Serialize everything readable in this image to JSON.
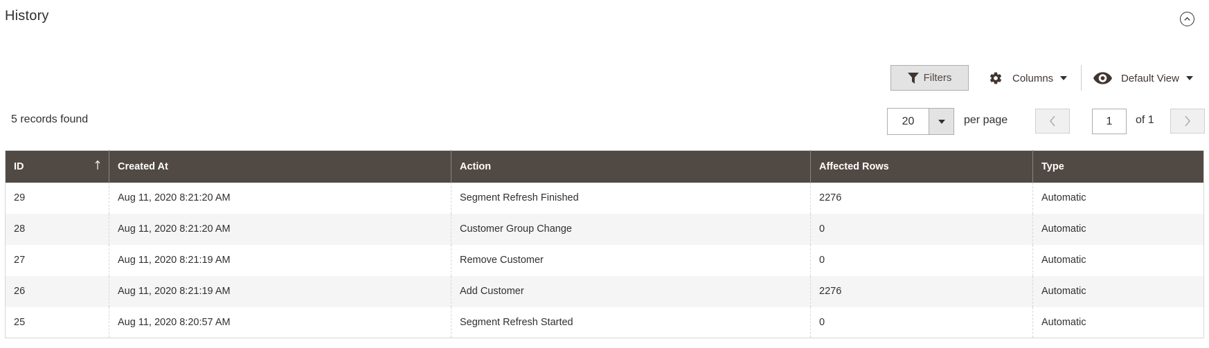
{
  "section": {
    "title": "History",
    "collapse_icon": "chevron-up-circle-icon"
  },
  "toolbar": {
    "filters_label": "Filters",
    "filters_icon": "funnel-icon",
    "columns_label": "Columns",
    "columns_icon": "gear-icon",
    "view_label": "Default View",
    "view_icon": "eye-icon"
  },
  "records_found": "5 records found",
  "pagination": {
    "per_page_value": "20",
    "per_page_label": "per page",
    "current_page": "1",
    "of_label": "of 1",
    "prev_icon": "chevron-left-icon",
    "next_icon": "chevron-right-icon"
  },
  "table": {
    "columns": [
      {
        "label": "ID",
        "sorted": "ascending"
      },
      {
        "label": "Created At"
      },
      {
        "label": "Action"
      },
      {
        "label": "Affected Rows"
      },
      {
        "label": "Type"
      }
    ],
    "rows": [
      {
        "id": "29",
        "created_at": "Aug 11, 2020 8:21:20 AM",
        "action": "Segment Refresh Finished",
        "affected_rows": "2276",
        "type": "Automatic"
      },
      {
        "id": "28",
        "created_at": "Aug 11, 2020 8:21:20 AM",
        "action": "Customer Group Change",
        "affected_rows": "0",
        "type": "Automatic"
      },
      {
        "id": "27",
        "created_at": "Aug 11, 2020 8:21:19 AM",
        "action": "Remove Customer",
        "affected_rows": "0",
        "type": "Automatic"
      },
      {
        "id": "26",
        "created_at": "Aug 11, 2020 8:21:19 AM",
        "action": "Add Customer",
        "affected_rows": "2276",
        "type": "Automatic"
      },
      {
        "id": "25",
        "created_at": "Aug 11, 2020 8:20:57 AM",
        "action": "Segment Refresh Started",
        "affected_rows": "0",
        "type": "Automatic"
      }
    ]
  },
  "colors": {
    "header_bg": "#514943",
    "header_text": "#ffffff",
    "button_bg": "#e3e3e3",
    "row_alt_bg": "#f5f5f5",
    "text": "#303030"
  }
}
